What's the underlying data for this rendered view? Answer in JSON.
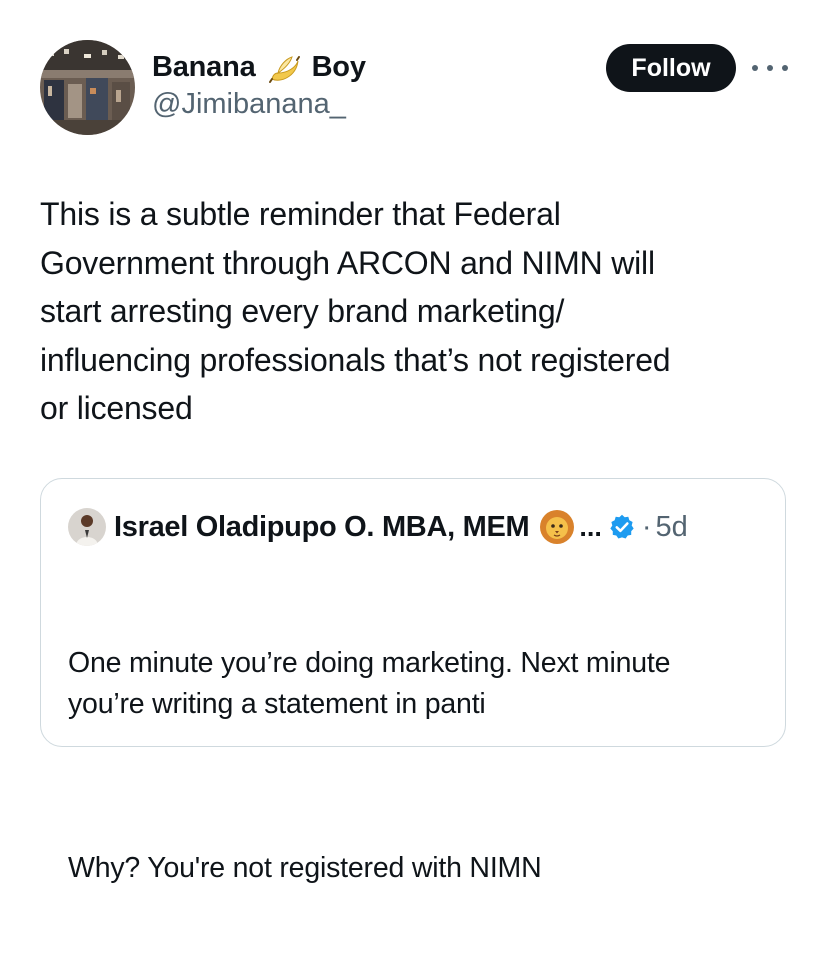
{
  "author": {
    "name_part1": "Banana",
    "emoji_icon": "banana-emoji-icon",
    "name_part2": "Boy",
    "handle": "@Jimibanana_"
  },
  "follow_label": "Follow",
  "more_icon": "more-options-icon",
  "tweet": {
    "text": "This is a subtle reminder that Federal\nGovernment through ARCON and NIMN will\nstart arresting every brand marketing/\ninfluencing professionals that’s not registered\nor licensed"
  },
  "quote": {
    "author_name": "Israel Oladipupo O. MBA, MEM",
    "emoji_icon": "lion-emoji-icon",
    "ellipsis": "...",
    "verified_icon": "verified-badge-icon",
    "separator": "·",
    "time": "5d",
    "text_p1": "One minute you’re doing marketing. Next minute\nyou’re writing a statement in panti",
    "text_p2": "Why? You're not registered with NIMN"
  },
  "colors": {
    "text": "#0f1419",
    "secondary": "#536471",
    "follow_bg": "#0f1419",
    "border": "#cfd9de",
    "verified": "#1d9bf0"
  }
}
